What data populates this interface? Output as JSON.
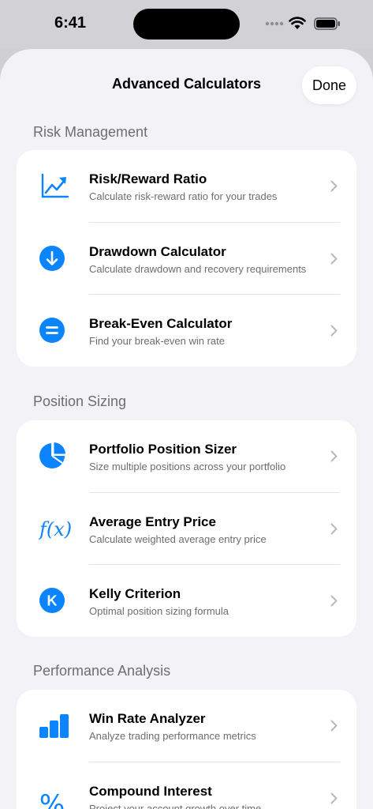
{
  "status_bar": {
    "time": "6:41"
  },
  "nav": {
    "title": "Advanced Calculators",
    "done_label": "Done"
  },
  "accent_color": "#0a84ff",
  "sections": [
    {
      "header": "Risk Management",
      "items": [
        {
          "title": "Risk/Reward Ratio",
          "subtitle": "Calculate risk-reward ratio for your trades",
          "icon": "chart-line-uptrend-icon"
        },
        {
          "title": "Drawdown Calculator",
          "subtitle": "Calculate drawdown and recovery requirements",
          "icon": "arrow-down-circle-icon"
        },
        {
          "title": "Break-Even Calculator",
          "subtitle": "Find your break-even win rate",
          "icon": "equal-circle-icon"
        }
      ]
    },
    {
      "header": "Position Sizing",
      "items": [
        {
          "title": "Portfolio Position Sizer",
          "subtitle": "Size multiple positions across your portfolio",
          "icon": "pie-chart-icon"
        },
        {
          "title": "Average Entry Price",
          "subtitle": "Calculate weighted average entry price",
          "icon": "function-icon",
          "icon_text": "f(x)"
        },
        {
          "title": "Kelly Criterion",
          "subtitle": "Optimal position sizing formula",
          "icon": "k-circle-icon",
          "icon_text": "K"
        }
      ]
    },
    {
      "header": "Performance Analysis",
      "items": [
        {
          "title": "Win Rate Analyzer",
          "subtitle": "Analyze trading performance metrics",
          "icon": "bar-chart-icon"
        },
        {
          "title": "Compound Interest",
          "subtitle": "Project your account growth over time",
          "icon": "percent-icon",
          "icon_text": "%"
        }
      ]
    }
  ]
}
